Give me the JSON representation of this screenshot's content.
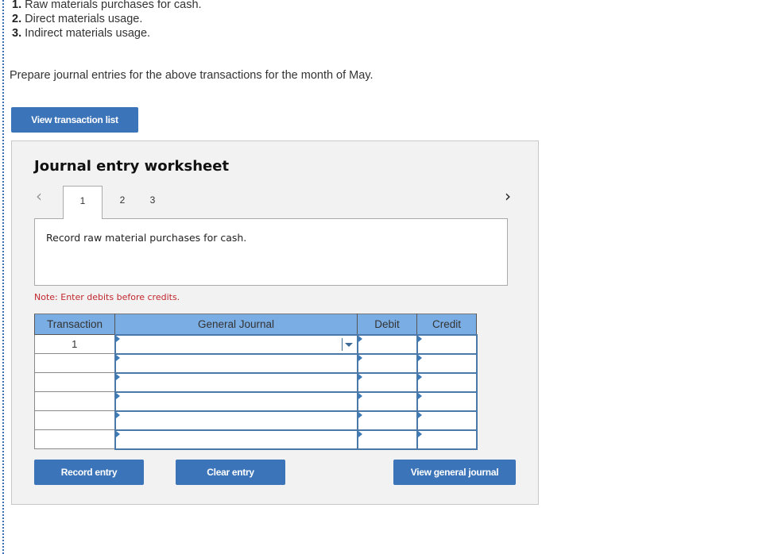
{
  "steps": [
    {
      "num": "1.",
      "text": "Raw materials purchases for cash."
    },
    {
      "num": "2.",
      "text": "Direct materials usage."
    },
    {
      "num": "3.",
      "text": "Indirect materials usage."
    }
  ],
  "instruction": "Prepare journal entries for the above transactions for the month of May.",
  "buttons": {
    "view_transaction_list": "View transaction list",
    "record_entry": "Record entry",
    "clear_entry": "Clear entry",
    "view_general_journal": "View general journal"
  },
  "worksheet": {
    "title": "Journal entry worksheet",
    "nav_prev": "<",
    "nav_next": ">",
    "tabs": [
      {
        "label": "1",
        "active": true
      },
      {
        "label": "2",
        "active": false
      },
      {
        "label": "3",
        "active": false
      }
    ],
    "prompt": "Record raw material purchases for cash.",
    "note": "Note: Enter debits before credits."
  },
  "journal": {
    "columns": [
      "Transaction",
      "General Journal",
      "Debit",
      "Credit"
    ],
    "rows": [
      {
        "transaction": "1",
        "account": "",
        "debit": "",
        "credit": ""
      },
      {
        "transaction": "",
        "account": "",
        "debit": "",
        "credit": ""
      },
      {
        "transaction": "",
        "account": "",
        "debit": "",
        "credit": ""
      },
      {
        "transaction": "",
        "account": "",
        "debit": "",
        "credit": ""
      },
      {
        "transaction": "",
        "account": "",
        "debit": "",
        "credit": ""
      },
      {
        "transaction": "",
        "account": "",
        "debit": "",
        "credit": ""
      }
    ]
  },
  "colors": {
    "accent_button": "#3b74b8",
    "table_header": "#7aade3",
    "note_text": "#c1272d",
    "input_border": "#4a78a8"
  }
}
